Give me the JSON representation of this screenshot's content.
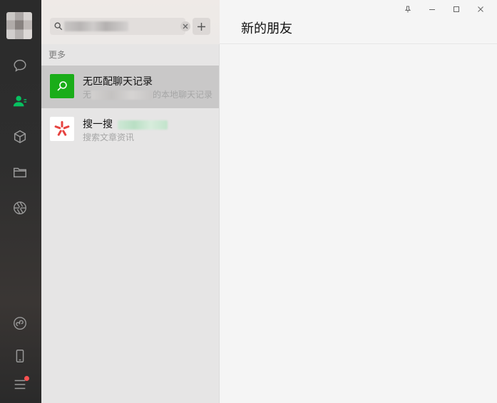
{
  "window": {
    "controls": [
      "pin",
      "minimize",
      "maximize",
      "close"
    ]
  },
  "nav": {
    "items": [
      {
        "name": "chat-icon"
      },
      {
        "name": "contacts-icon",
        "active": true
      },
      {
        "name": "box-icon"
      },
      {
        "name": "folder-icon"
      },
      {
        "name": "moments-icon"
      },
      {
        "name": "mini-program-icon"
      },
      {
        "name": "phone-icon"
      },
      {
        "name": "menu-icon",
        "badge": true
      }
    ],
    "active_color": "#07c160",
    "badge_color": "#fa5151"
  },
  "search": {
    "value": "",
    "placeholder": ""
  },
  "results": {
    "section_label": "更多",
    "items": [
      {
        "title": "无匹配聊天记录",
        "sub_prefix": "无",
        "sub_suffix": "的本地聊天记录",
        "icon": "search-icon",
        "icon_bg": "#1aad19"
      },
      {
        "title": "搜一搜",
        "sub": "搜索文章资讯",
        "icon": "sousou-icon",
        "icon_bg": "#ffffff"
      }
    ]
  },
  "content": {
    "title": "新的朋友"
  }
}
